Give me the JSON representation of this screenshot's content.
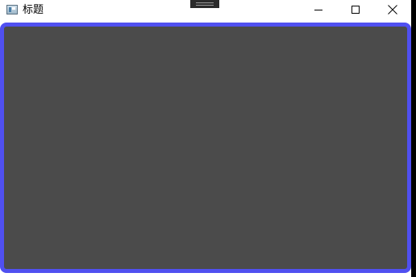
{
  "window": {
    "title": "标题",
    "app_icon": "app-window-icon"
  },
  "controls": {
    "minimize_icon": "minimize-icon",
    "maximize_icon": "maximize-icon",
    "close_icon": "close-icon"
  },
  "colors": {
    "canvas_border": "#5050f0",
    "canvas_fill": "#4b4b4b",
    "titlebar": "#ffffff"
  }
}
